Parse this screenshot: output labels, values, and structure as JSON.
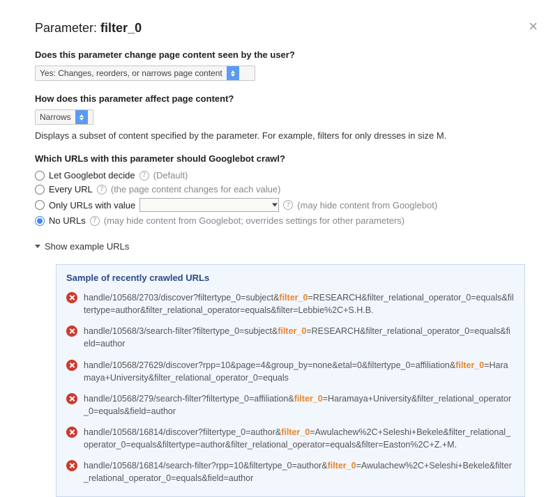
{
  "title_prefix": "Parameter: ",
  "title_param": "filter_0",
  "q1": "Does this parameter change page content seen by the user?",
  "sel1": "Yes: Changes, reorders, or narrows page content",
  "q2": "How does this parameter affect page content?",
  "sel2": "Narrows",
  "desc2": "Displays a subset of content specified by the parameter. For example, filters for only dresses in size M.",
  "q3": "Which URLs with this parameter should Googlebot crawl?",
  "radios": [
    {
      "label": "Let Googlebot decide ",
      "hint": "(Default)",
      "has_help": true,
      "has_input": false,
      "checked": false
    },
    {
      "label": "Every URL ",
      "hint": "(the page content changes for each value)",
      "has_help": true,
      "has_input": false,
      "checked": false
    },
    {
      "label": "Only URLs with value ",
      "hint": "(may hide content from Googlebot)",
      "has_help": true,
      "has_input": true,
      "checked": false
    },
    {
      "label": "No URLs ",
      "hint": "(may hide content from Googlebot; overrides settings for other parameters)",
      "has_help": true,
      "has_input": false,
      "checked": true
    }
  ],
  "toggle_label": "Show example URLs",
  "sample_title": "Sample of recently crawled URLs",
  "highlight_param": "filter_0",
  "urls": [
    {
      "pre": "handle/10568/2703/discover?filtertype_0=subject&",
      "post": "=RESEARCH&filter_relational_operator_0=equals&filtertype=author&filter_relational_operator=equals&filter=Lebbie%2C+S.H.B."
    },
    {
      "pre": "handle/10568/3/search-filter?filtertype_0=subject&",
      "post": "=RESEARCH&filter_relational_operator_0=equals&field=author"
    },
    {
      "pre": "handle/10568/27629/discover?rpp=10&page=4&group_by=none&etal=0&filtertype_0=affiliation&",
      "post": "=Haramaya+University&filter_relational_operator_0=equals"
    },
    {
      "pre": "handle/10568/279/search-filter?filtertype_0=affiliation&",
      "post": "=Haramaya+University&filter_relational_operator_0=equals&field=author"
    },
    {
      "pre": "handle/10568/16814/discover?filtertype_0=author&",
      "post": "=Awulachew%2C+Seleshi+Bekele&filter_relational_operator_0=equals&filtertype=author&filter_relational_operator=equals&filter=Easton%2C+Z.+M."
    },
    {
      "pre": "handle/10568/16814/search-filter?rpp=10&filtertype_0=author&",
      "post": "=Awulachew%2C+Seleshi+Bekele&filter_relational_operator_0=equals&field=author"
    }
  ]
}
